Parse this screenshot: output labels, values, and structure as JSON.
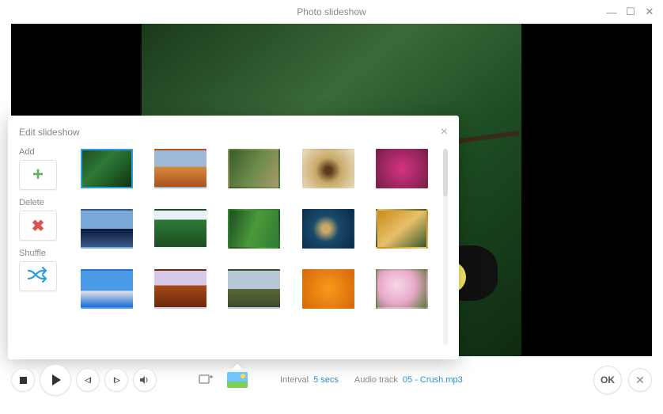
{
  "titlebar": {
    "title": "Photo slideshow"
  },
  "popover": {
    "title": "Edit slideshow",
    "labels": {
      "add": "Add",
      "delete": "Delete",
      "shuffle": "Shuffle"
    },
    "thumbs": [
      {
        "name": "toucan-rainforest",
        "selected": true
      },
      {
        "name": "desert-dunes",
        "selected": false
      },
      {
        "name": "forest-stream",
        "selected": false
      },
      {
        "name": "lone-tree-sunset",
        "selected": false
      },
      {
        "name": "pink-flowers-macro",
        "selected": false
      },
      {
        "name": "whale-tail-ocean",
        "selected": false
      },
      {
        "name": "railroad-forest",
        "selected": false
      },
      {
        "name": "dense-green-jungle",
        "selected": false
      },
      {
        "name": "sea-turtle",
        "selected": false
      },
      {
        "name": "autumn-bird",
        "selected": false
      },
      {
        "name": "tropical-island-sea",
        "selected": false
      },
      {
        "name": "monument-valley",
        "selected": false
      },
      {
        "name": "green-river-valley",
        "selected": false
      },
      {
        "name": "orange-marigolds",
        "selected": false
      },
      {
        "name": "cherry-blossom",
        "selected": false
      }
    ]
  },
  "controls": {
    "interval_label": "Interval",
    "interval_value": "5 secs",
    "audio_label": "Audio track",
    "audio_value": "05 - Crush.mp3",
    "ok_label": "OK"
  }
}
